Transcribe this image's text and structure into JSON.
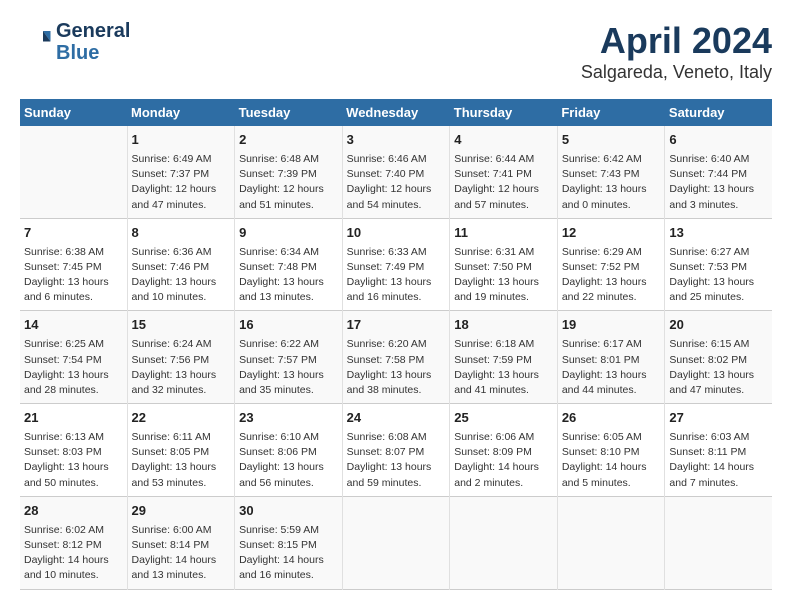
{
  "logo": {
    "line1": "General",
    "line2": "Blue"
  },
  "title": "April 2024",
  "subtitle": "Salgareda, Veneto, Italy",
  "days_of_week": [
    "Sunday",
    "Monday",
    "Tuesday",
    "Wednesday",
    "Thursday",
    "Friday",
    "Saturday"
  ],
  "weeks": [
    [
      {
        "day": "",
        "content": ""
      },
      {
        "day": "1",
        "content": "Sunrise: 6:49 AM\nSunset: 7:37 PM\nDaylight: 12 hours\nand 47 minutes."
      },
      {
        "day": "2",
        "content": "Sunrise: 6:48 AM\nSunset: 7:39 PM\nDaylight: 12 hours\nand 51 minutes."
      },
      {
        "day": "3",
        "content": "Sunrise: 6:46 AM\nSunset: 7:40 PM\nDaylight: 12 hours\nand 54 minutes."
      },
      {
        "day": "4",
        "content": "Sunrise: 6:44 AM\nSunset: 7:41 PM\nDaylight: 12 hours\nand 57 minutes."
      },
      {
        "day": "5",
        "content": "Sunrise: 6:42 AM\nSunset: 7:43 PM\nDaylight: 13 hours\nand 0 minutes."
      },
      {
        "day": "6",
        "content": "Sunrise: 6:40 AM\nSunset: 7:44 PM\nDaylight: 13 hours\nand 3 minutes."
      }
    ],
    [
      {
        "day": "7",
        "content": "Sunrise: 6:38 AM\nSunset: 7:45 PM\nDaylight: 13 hours\nand 6 minutes."
      },
      {
        "day": "8",
        "content": "Sunrise: 6:36 AM\nSunset: 7:46 PM\nDaylight: 13 hours\nand 10 minutes."
      },
      {
        "day": "9",
        "content": "Sunrise: 6:34 AM\nSunset: 7:48 PM\nDaylight: 13 hours\nand 13 minutes."
      },
      {
        "day": "10",
        "content": "Sunrise: 6:33 AM\nSunset: 7:49 PM\nDaylight: 13 hours\nand 16 minutes."
      },
      {
        "day": "11",
        "content": "Sunrise: 6:31 AM\nSunset: 7:50 PM\nDaylight: 13 hours\nand 19 minutes."
      },
      {
        "day": "12",
        "content": "Sunrise: 6:29 AM\nSunset: 7:52 PM\nDaylight: 13 hours\nand 22 minutes."
      },
      {
        "day": "13",
        "content": "Sunrise: 6:27 AM\nSunset: 7:53 PM\nDaylight: 13 hours\nand 25 minutes."
      }
    ],
    [
      {
        "day": "14",
        "content": "Sunrise: 6:25 AM\nSunset: 7:54 PM\nDaylight: 13 hours\nand 28 minutes."
      },
      {
        "day": "15",
        "content": "Sunrise: 6:24 AM\nSunset: 7:56 PM\nDaylight: 13 hours\nand 32 minutes."
      },
      {
        "day": "16",
        "content": "Sunrise: 6:22 AM\nSunset: 7:57 PM\nDaylight: 13 hours\nand 35 minutes."
      },
      {
        "day": "17",
        "content": "Sunrise: 6:20 AM\nSunset: 7:58 PM\nDaylight: 13 hours\nand 38 minutes."
      },
      {
        "day": "18",
        "content": "Sunrise: 6:18 AM\nSunset: 7:59 PM\nDaylight: 13 hours\nand 41 minutes."
      },
      {
        "day": "19",
        "content": "Sunrise: 6:17 AM\nSunset: 8:01 PM\nDaylight: 13 hours\nand 44 minutes."
      },
      {
        "day": "20",
        "content": "Sunrise: 6:15 AM\nSunset: 8:02 PM\nDaylight: 13 hours\nand 47 minutes."
      }
    ],
    [
      {
        "day": "21",
        "content": "Sunrise: 6:13 AM\nSunset: 8:03 PM\nDaylight: 13 hours\nand 50 minutes."
      },
      {
        "day": "22",
        "content": "Sunrise: 6:11 AM\nSunset: 8:05 PM\nDaylight: 13 hours\nand 53 minutes."
      },
      {
        "day": "23",
        "content": "Sunrise: 6:10 AM\nSunset: 8:06 PM\nDaylight: 13 hours\nand 56 minutes."
      },
      {
        "day": "24",
        "content": "Sunrise: 6:08 AM\nSunset: 8:07 PM\nDaylight: 13 hours\nand 59 minutes."
      },
      {
        "day": "25",
        "content": "Sunrise: 6:06 AM\nSunset: 8:09 PM\nDaylight: 14 hours\nand 2 minutes."
      },
      {
        "day": "26",
        "content": "Sunrise: 6:05 AM\nSunset: 8:10 PM\nDaylight: 14 hours\nand 5 minutes."
      },
      {
        "day": "27",
        "content": "Sunrise: 6:03 AM\nSunset: 8:11 PM\nDaylight: 14 hours\nand 7 minutes."
      }
    ],
    [
      {
        "day": "28",
        "content": "Sunrise: 6:02 AM\nSunset: 8:12 PM\nDaylight: 14 hours\nand 10 minutes."
      },
      {
        "day": "29",
        "content": "Sunrise: 6:00 AM\nSunset: 8:14 PM\nDaylight: 14 hours\nand 13 minutes."
      },
      {
        "day": "30",
        "content": "Sunrise: 5:59 AM\nSunset: 8:15 PM\nDaylight: 14 hours\nand 16 minutes."
      },
      {
        "day": "",
        "content": ""
      },
      {
        "day": "",
        "content": ""
      },
      {
        "day": "",
        "content": ""
      },
      {
        "day": "",
        "content": ""
      }
    ]
  ]
}
